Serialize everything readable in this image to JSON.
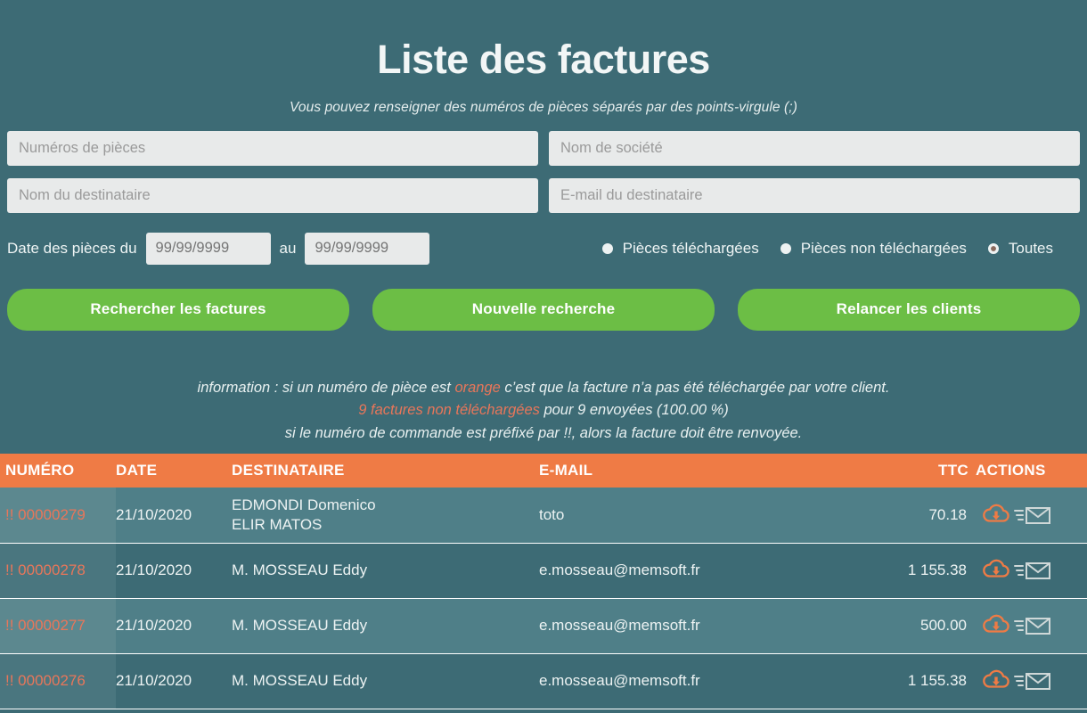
{
  "header": {
    "title": "Liste des factures",
    "subtitle": "Vous pouvez renseigner des numéros de pièces séparés par des points-virgule (;)"
  },
  "form": {
    "numeros_placeholder": "Numéros de pièces",
    "numeros_value": "",
    "societe_placeholder": "Nom de société",
    "societe_value": "",
    "destinataire_placeholder": "Nom du destinataire",
    "destinataire_value": "",
    "email_placeholder": "E-mail du destinataire",
    "email_value": "",
    "date_label": "Date des pièces du",
    "date_from_placeholder": "99/99/9999",
    "date_from_value": "",
    "date_sep_label": "au",
    "date_to_placeholder": "99/99/9999",
    "date_to_value": ""
  },
  "radios": [
    {
      "label": "Pièces téléchargées",
      "selected": false,
      "name": "radio-pieces-telechargees"
    },
    {
      "label": "Pièces non téléchargées",
      "selected": false,
      "name": "radio-pieces-non-telechargees"
    },
    {
      "label": "Toutes",
      "selected": true,
      "name": "radio-toutes"
    }
  ],
  "buttons": {
    "search": "Rechercher les factures",
    "new_search": "Nouvelle recherche",
    "remind": "Relancer les clients"
  },
  "info": {
    "line1_part1": "information : si un numéro de pièce est ",
    "line1_orange": "orange",
    "line1_part2": " c’est que la facture n’a pas été téléchargée par votre client.",
    "line2_orange": "9 factures non téléchargées",
    "line2_rest": " pour 9 envoyées (100.00 %)",
    "line3": "si le numéro de commande est préfixé par !!, alors la facture doit être renvoyée."
  },
  "table": {
    "columns": [
      "NUMÉRO",
      "DATE",
      "DESTINATAIRE",
      "E-MAIL",
      "TTC",
      "ACTIONS"
    ],
    "rows": [
      {
        "numero": "!! 00000279",
        "date": "21/10/2020",
        "destinataire_line1": "EDMONDI Domenico",
        "destinataire_line2": "ELIR MATOS",
        "email": "toto",
        "ttc": "70.18",
        "shade": "light"
      },
      {
        "numero": "!! 00000278",
        "date": "21/10/2020",
        "destinataire_line1": "M. MOSSEAU Eddy",
        "destinataire_line2": "",
        "email": "e.mosseau@memsoft.fr",
        "ttc": "1 155.38",
        "shade": "dark"
      },
      {
        "numero": "!! 00000277",
        "date": "21/10/2020",
        "destinataire_line1": "M. MOSSEAU Eddy",
        "destinataire_line2": "",
        "email": "e.mosseau@memsoft.fr",
        "ttc": "500.00",
        "shade": "light"
      },
      {
        "numero": "!! 00000276",
        "date": "21/10/2020",
        "destinataire_line1": "M. MOSSEAU Eddy",
        "destinataire_line2": "",
        "email": "e.mosseau@memsoft.fr",
        "ttc": "1 155.38",
        "shade": "dark"
      }
    ],
    "action_icons": [
      "cloud-download-icon",
      "send-email-icon"
    ]
  },
  "colors": {
    "background": "#3d6b75",
    "row_light": "#4f7f88",
    "header_orange": "#ef7b45",
    "accent_orange": "#e8765a",
    "button_green": "#6cbe45",
    "field_gray": "#e8eaea",
    "text_light": "#edf3f3"
  }
}
